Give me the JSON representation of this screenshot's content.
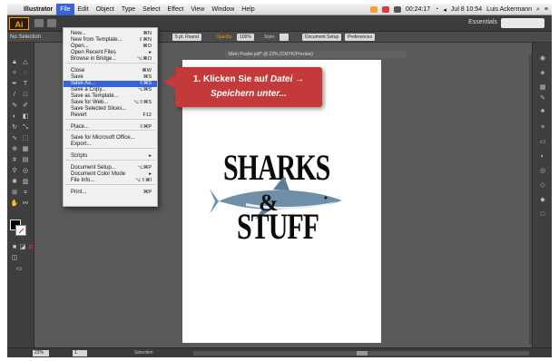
{
  "menubar": {
    "app_name": "Illustrator",
    "items": [
      "File",
      "Edit",
      "Object",
      "Type",
      "Select",
      "Effect",
      "View",
      "Window",
      "Help"
    ],
    "active_item": "File",
    "battery": "00:24:17",
    "date_time": "Jul 8  10:54",
    "user": "Luis Ackermann"
  },
  "appbar": {
    "logo": "Ai",
    "workspace": "Essentials"
  },
  "controlbar": {
    "selection": "No Selection",
    "stroke_weight": "5 pt. Round",
    "opacity_label": "Opacity:",
    "opacity_value": "100%",
    "style_label": "Style:",
    "doc_setup": "Document Setup",
    "preferences": "Preferences"
  },
  "document": {
    "tab_title": "Mein Poster.pdf* @ 22% (CMYK/Preview)",
    "art_line1": "SHARKS",
    "art_amp": "&",
    "art_line2": "STUFF"
  },
  "file_menu": {
    "items": [
      {
        "label": "New...",
        "shortcut": "⌘N"
      },
      {
        "label": "New from Template...",
        "shortcut": "⇧⌘N"
      },
      {
        "label": "Open...",
        "shortcut": "⌘O"
      },
      {
        "label": "Open Recent Files",
        "shortcut": "▸"
      },
      {
        "label": "Browse in Bridge...",
        "shortcut": "⌥⌘O"
      },
      {
        "label": "Close",
        "shortcut": "⌘W"
      },
      {
        "label": "Save",
        "shortcut": "⌘S"
      },
      {
        "label": "Save As...",
        "shortcut": "⇧⌘S"
      },
      {
        "label": "Save a Copy...",
        "shortcut": "⌥⌘S"
      },
      {
        "label": "Save as Template...",
        "shortcut": ""
      },
      {
        "label": "Save for Web...",
        "shortcut": "⌥⇧⌘S"
      },
      {
        "label": "Save Selected Slices...",
        "shortcut": ""
      },
      {
        "label": "Revert",
        "shortcut": "F12"
      },
      {
        "label": "Place...",
        "shortcut": "⇧⌘P"
      },
      {
        "label": "Save for Microsoft Office...",
        "shortcut": ""
      },
      {
        "label": "Export...",
        "shortcut": ""
      },
      {
        "label": "Scripts",
        "shortcut": "▸"
      },
      {
        "label": "Document Setup...",
        "shortcut": "⌥⌘P"
      },
      {
        "label": "Document Color Mode",
        "shortcut": "▸"
      },
      {
        "label": "File Info...",
        "shortcut": "⌥⇧⌘I"
      },
      {
        "label": "Print...",
        "shortcut": "⌘P"
      }
    ],
    "highlighted": "Save As..."
  },
  "callout": {
    "line1_prefix": "1. Klicken Sie auf ",
    "line1_italic": "Datei",
    "line1_arrow": " →",
    "line2": "Speichern unter..."
  },
  "statusbar": {
    "zoom": "22%",
    "page": "1",
    "tool": "Selection"
  },
  "colors": {
    "accent": "#3a64d6",
    "callout": "#c43a3a",
    "ai_orange": "#ff9a00"
  }
}
